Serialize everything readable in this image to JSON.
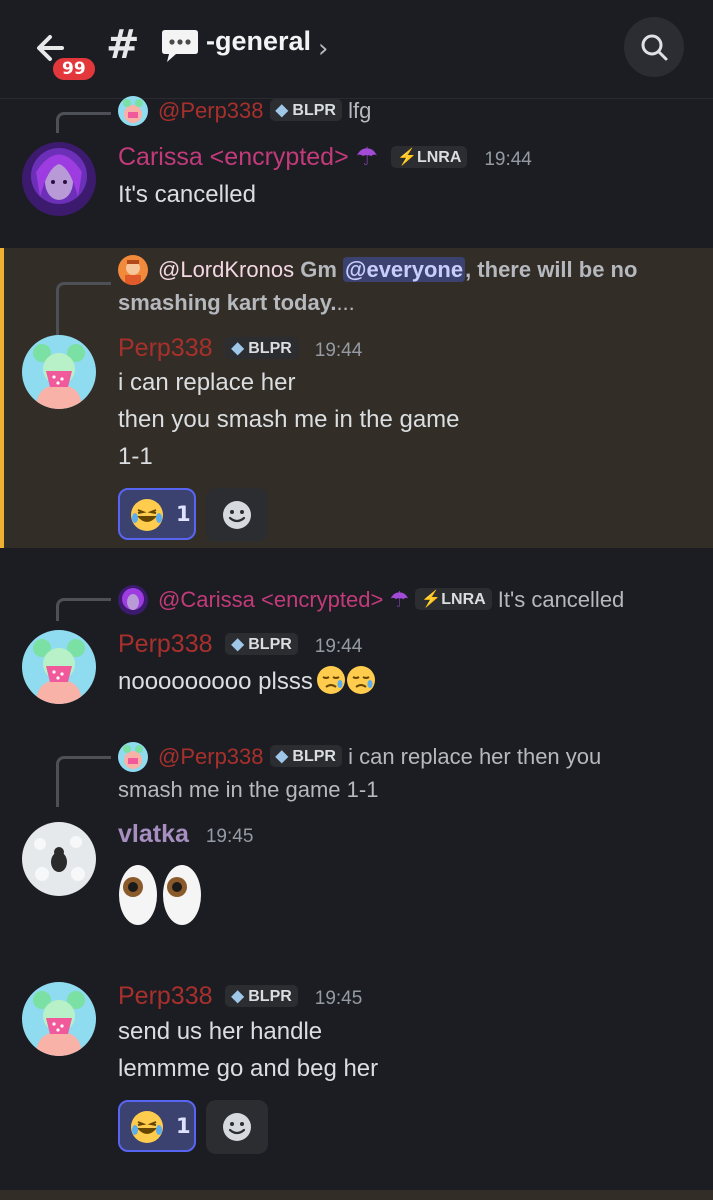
{
  "header": {
    "badge_count": "99",
    "hash": "#",
    "channel_name": "-general",
    "chevron": "›"
  },
  "messages": [
    {
      "reply": {
        "mention": "@Perp338",
        "tag": "BLPR",
        "text": "lfg"
      },
      "author": "Carissa <encrypted>",
      "tag": "LNRA",
      "time": "19:44",
      "lines": [
        "It's cancelled"
      ]
    },
    {
      "reply": {
        "mention": "@LordKronos",
        "text_a": "Gm ",
        "everyone": "@everyone",
        "text_b": ", there will be no",
        "text_c": "smashing  kart today.",
        "ellipsis": "..."
      },
      "author": "Perp338",
      "tag": "BLPR",
      "time": "19:44",
      "lines": [
        "i can replace her",
        "then you smash me in the game",
        "1-1"
      ],
      "reaction_count": "1"
    },
    {
      "reply": {
        "mention": "@Carissa <encrypted>",
        "tag": "LNRA",
        "text": "It's cancelled"
      },
      "author": "Perp338",
      "tag": "BLPR",
      "time": "19:44",
      "lines": [
        "nooooooooo plsss"
      ]
    },
    {
      "reply": {
        "mention": "@Perp338",
        "tag": "BLPR",
        "text": "i can replace her then you",
        "text2": "smash me in the game 1-1"
      },
      "author": "vlatka",
      "time": "19:45",
      "lines": []
    },
    {
      "author": "Perp338",
      "tag": "BLPR",
      "time": "19:45",
      "lines": [
        "send us her handle",
        "lemmme go and beg her"
      ],
      "reaction_count": "1"
    }
  ],
  "colors": {
    "background": "#1c1d22",
    "highlight": "#322d27",
    "highlight_border": "#f0b132",
    "carissa": "#c23a7a",
    "perp": "#a8302c",
    "vlatka": "#a68fc0",
    "accent": "#5865f2"
  },
  "icons": [
    "back-arrow-icon",
    "search-icon",
    "speech-bubble-icon",
    "umbrella-icon",
    "lightning-icon",
    "droplet-icon",
    "smile-add-reaction-icon",
    "laughing-emoji",
    "eyes-emoji",
    "sleepy-emoji"
  ]
}
